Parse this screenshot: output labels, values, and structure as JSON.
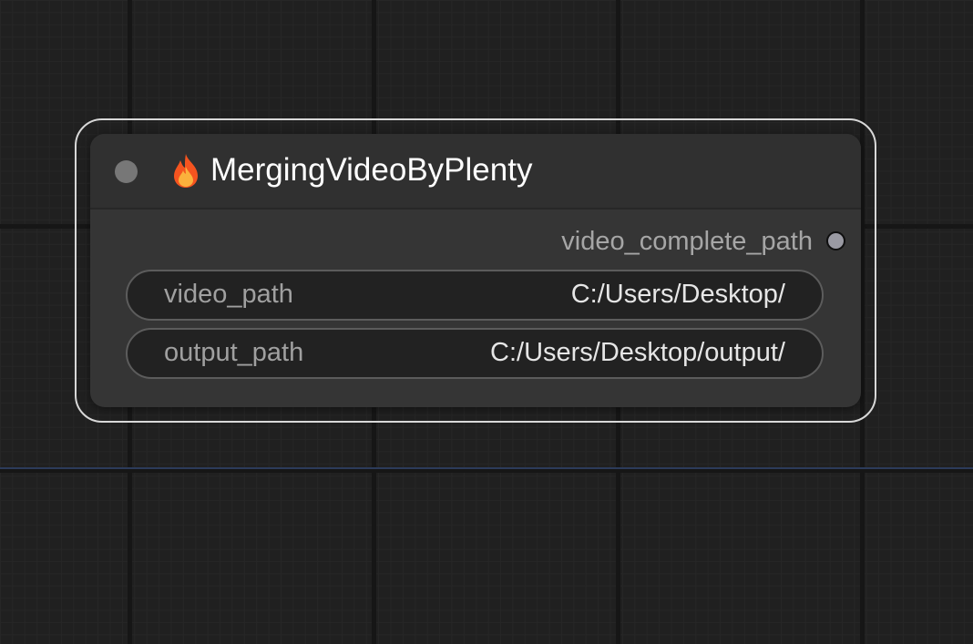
{
  "node": {
    "title": "MergingVideoByPlenty",
    "icon": "flame-icon",
    "outputs": [
      {
        "label": "video_complete_path"
      }
    ],
    "widgets": [
      {
        "label": "video_path",
        "value": "C:/Users/Desktop/"
      },
      {
        "label": "output_path",
        "value": "C:/Users/Desktop/output/"
      }
    ]
  },
  "colors": {
    "canvas_background": "#202020",
    "node_body": "#353535",
    "node_header": "#303030",
    "selection_outline": "#d8d8d8",
    "widget_background": "#222222",
    "link": "#2c3b5a"
  }
}
